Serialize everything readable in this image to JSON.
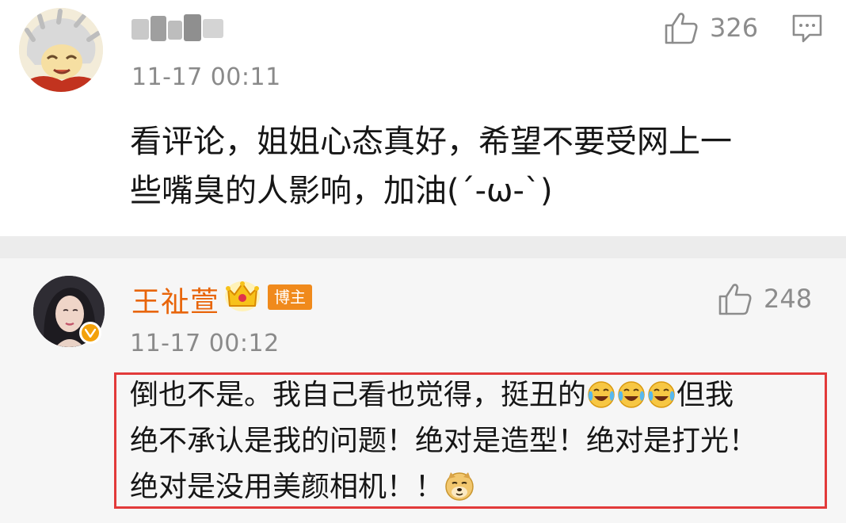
{
  "comment1": {
    "time": "11-17 00:11",
    "like_count": "326",
    "text_line1": "看评论，姐姐心态真好，希望不要受网上一",
    "text_line2": "些嘴臭的人影响，加油(´-ω-`)"
  },
  "comment2": {
    "author": "王祉萱",
    "badge": "博主",
    "time": "11-17 00:12",
    "like_count": "248",
    "line1_a": "倒也不是。我自己看也觉得，挺丑的",
    "line1_b": "但我",
    "line2": "绝不承认是我的问题！绝对是造型！绝对是打光！",
    "line3": "绝对是没用美颜相机！！"
  },
  "colors": {
    "author_name": "#e8650a",
    "owner_badge": "#f08a1c",
    "highlight_border": "#e23a3a",
    "meta_gray": "#8a8a8a"
  },
  "icons": [
    "like-icon",
    "reply-icon",
    "crown-icon",
    "verified-badge-icon",
    "laugh-cry-emoji",
    "doge-emoji"
  ]
}
